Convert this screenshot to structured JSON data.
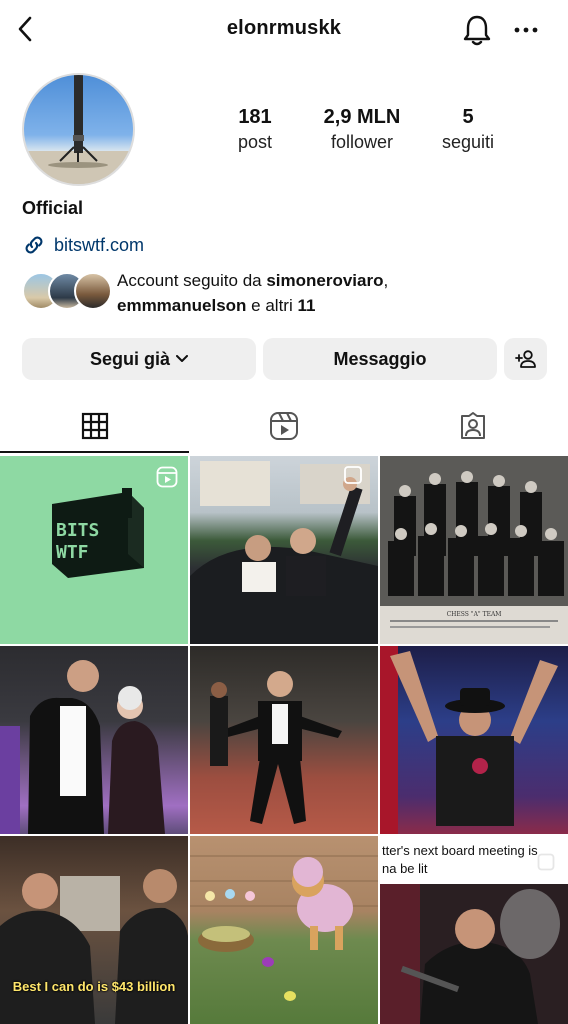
{
  "header": {
    "username": "elonrmuskk",
    "back_icon": "chevron-left-icon",
    "bell_icon": "bell-icon",
    "more_icon": "ellipsis-icon"
  },
  "profile": {
    "stats": [
      {
        "value": "181",
        "label": "post"
      },
      {
        "value": "2,9 MLN",
        "label": "follower"
      },
      {
        "value": "5",
        "label": "seguiti"
      }
    ],
    "name": "Official",
    "link": "bitswtf.com",
    "mutual": {
      "prefix": "Account seguito da ",
      "user1": "simoneroviaro",
      "sep": ",",
      "user2": "emmmanuelson",
      "middle": " e altri ",
      "count": "11"
    }
  },
  "actions": {
    "follow_label": "Segui già",
    "message_label": "Messaggio",
    "add_icon": "add-person-icon"
  },
  "tabs": [
    {
      "name": "grid",
      "icon": "grid-icon",
      "active": true
    },
    {
      "name": "reels",
      "icon": "reels-icon",
      "active": false
    },
    {
      "name": "tagged",
      "icon": "tagged-person-icon",
      "active": false
    }
  ],
  "posts": {
    "bits_text_1": "BITS",
    "bits_text_2": "WTF",
    "caption_billion": "Best I can do is $43 billion",
    "caption_board_1": "tter's next board meeting is",
    "caption_board_2": "na be lit",
    "team_caption": "CHESS \"A\" TEAM"
  },
  "colors": {
    "link": "#00376b",
    "button_bg": "#efefef",
    "bits_green": "#8ed9a3"
  }
}
